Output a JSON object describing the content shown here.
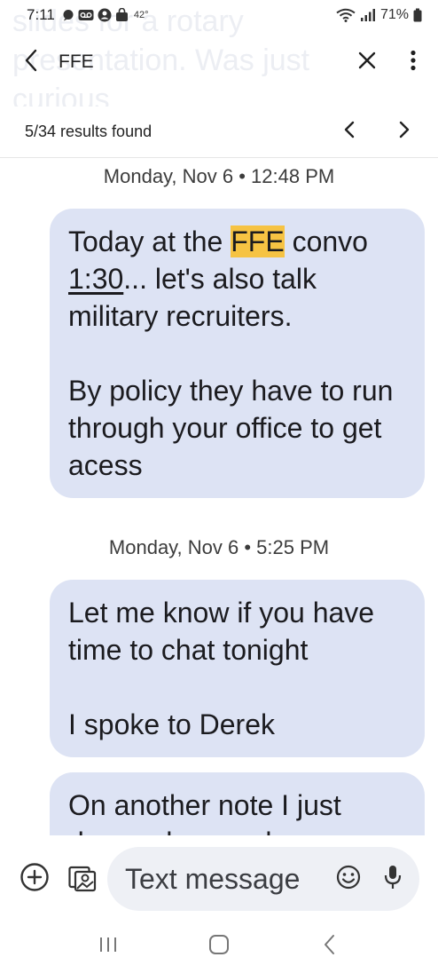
{
  "status_bar": {
    "time": "7:11",
    "temperature": "42°",
    "battery": "71%"
  },
  "ghost_text": "slides for a rotary\npresentation. Was just\ncurious",
  "search": {
    "query": "FFE",
    "results_count": "5/34 results found"
  },
  "messages": [
    {
      "date": "Monday, Nov 6 • 12:48 PM",
      "paragraphs": [
        {
          "before": "Today at the ",
          "highlight": "FFE",
          "after": " convo"
        },
        {
          "link": "1:30",
          "rest": "... let's also talk military recruiters."
        },
        {
          "text": "By policy they have to run through your office to get acess"
        }
      ]
    },
    {
      "date": "Monday, Nov 6 • 5:25 PM",
      "paragraphs": [
        {
          "text": "Let me know if you have time to chat tonight"
        },
        {
          "text": "I spoke to Derek"
        }
      ]
    },
    {
      "paragraphs": [
        {
          "text": "On another note I just dropped a couple"
        }
      ]
    }
  ],
  "compose": {
    "placeholder": "Text message"
  },
  "icons": {
    "back": "arrow-left-icon",
    "close": "close-icon",
    "more": "more-vert-icon",
    "prev": "chevron-left-icon",
    "next": "chevron-right-icon",
    "add": "add-circle-icon",
    "gallery": "gallery-icon",
    "emoji": "emoji-icon",
    "mic": "mic-icon",
    "recents": "recents-icon",
    "home": "home-icon",
    "nav_back": "nav-back-icon"
  },
  "colors": {
    "bubble": "#dde3f4",
    "highlight": "#f6c343",
    "compose_field": "#eef0f5"
  }
}
